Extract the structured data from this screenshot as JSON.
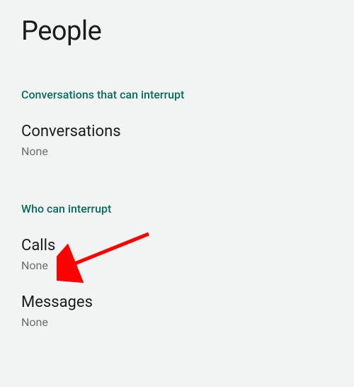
{
  "title": "People",
  "sections": [
    {
      "header": "Conversations that can interrupt",
      "items": [
        {
          "title": "Conversations",
          "subtitle": "None"
        }
      ]
    },
    {
      "header": "Who can interrupt",
      "items": [
        {
          "title": "Calls",
          "subtitle": "None"
        },
        {
          "title": "Messages",
          "subtitle": "None"
        }
      ]
    }
  ]
}
